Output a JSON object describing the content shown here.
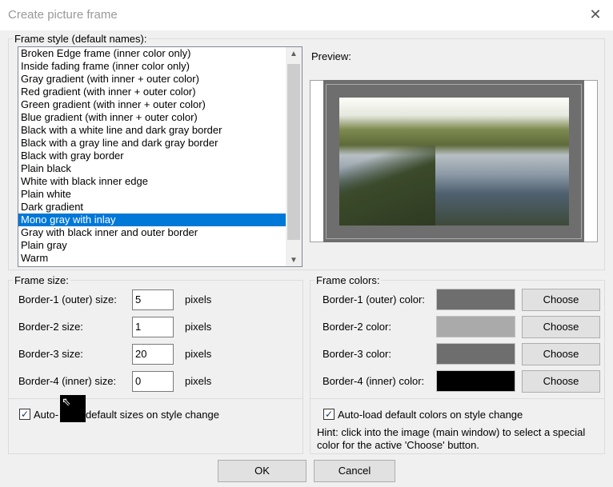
{
  "title": "Create picture frame",
  "frame_style": {
    "label": "Frame style (default names):",
    "selected_index": 13,
    "items": [
      "Broken Edge frame (inner color only)",
      "Inside fading frame (inner color only)",
      "Gray gradient (with inner + outer color)",
      "Red gradient (with inner + outer color)",
      "Green gradient (with inner + outer color)",
      "Blue gradient (with inner + outer color)",
      "Black with a white line and dark gray border",
      "Black with a gray line and dark gray border",
      "Black with gray border",
      "Plain black",
      "White with black inner edge",
      "Plain white",
      "Dark gradient",
      "Mono gray with inlay",
      "Gray with black inner and outer border",
      "Plain gray",
      "Warm"
    ]
  },
  "preview_label": "Preview:",
  "frame_size": {
    "label": "Frame size:",
    "unit": "pixels",
    "rows": [
      {
        "label": "Border-1 (outer) size:",
        "value": "5"
      },
      {
        "label": "Border-2 size:",
        "value": "1"
      },
      {
        "label": "Border-3 size:",
        "value": "20"
      },
      {
        "label": "Border-4 (inner) size:",
        "value": "0"
      }
    ],
    "auto_a": "Auto-",
    "auto_b": "default sizes on style change"
  },
  "frame_colors": {
    "label": "Frame colors:",
    "choose": "Choose",
    "rows": [
      {
        "label": "Border-1 (outer) color:",
        "color": "#6e6e6e"
      },
      {
        "label": "Border-2 color:",
        "color": "#aaaaaa"
      },
      {
        "label": "Border-3 color:",
        "color": "#6e6e6e"
      },
      {
        "label": "Border-4 (inner) color:",
        "color": "#000000"
      }
    ],
    "auto": "Auto-load default colors on style change",
    "hint": "Hint: click into the image (main window) to select a special color for the active 'Choose' button."
  },
  "ok": "OK",
  "cancel": "Cancel"
}
